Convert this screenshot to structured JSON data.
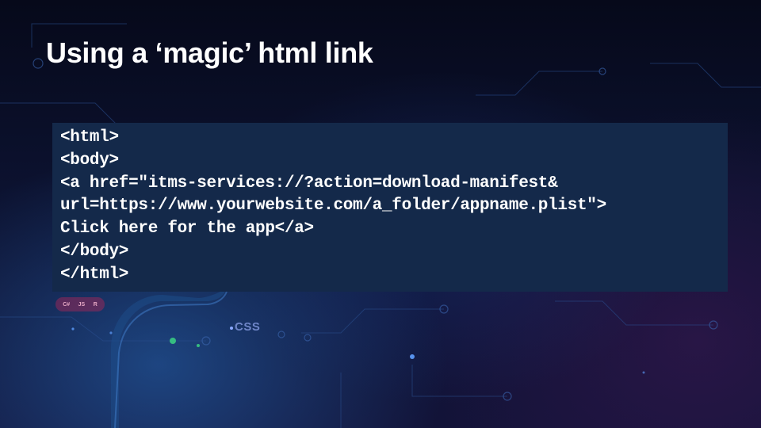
{
  "slide": {
    "title": "Using a ‘magic’ html link",
    "code_lines": [
      "<html>",
      "<body>",
      "<a href=\"itms-services://?action=download-manifest&",
      "url=https://www.yourwebsite.com/a_folder/appname.plist\">",
      "Click here for the app</a>",
      "</body>",
      "</html>"
    ]
  },
  "background": {
    "chip_labels": [
      "C#",
      "JS",
      "R"
    ],
    "css_label": "CSS",
    "colors": {
      "code_box": "#14294a",
      "title_text": "#ffffff",
      "glow": "#2f6fbf"
    }
  }
}
